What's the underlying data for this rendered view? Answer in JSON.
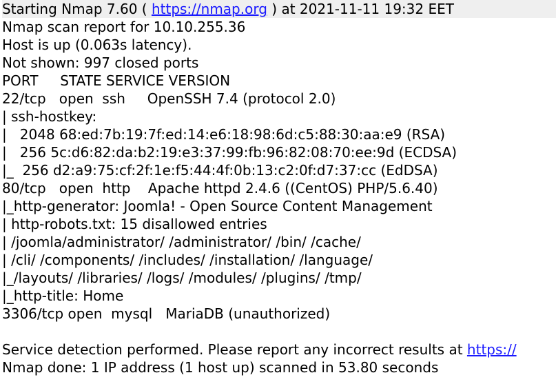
{
  "colors": {
    "text": "#000000",
    "link": "#1a1aff",
    "background": "#ffffff",
    "first_line_background": "#efefef"
  },
  "lines": [
    {
      "parts": [
        {
          "text": "Starting Nmap 7.60 ( "
        },
        {
          "text": "https://nmap.org",
          "link": true
        },
        {
          "text": " ) at 2021-11-11 19:32 EET"
        }
      ]
    },
    {
      "parts": [
        {
          "text": "Nmap scan report for 10.10.255.36"
        }
      ]
    },
    {
      "parts": [
        {
          "text": "Host is up (0.063s latency)."
        }
      ]
    },
    {
      "parts": [
        {
          "text": "Not shown: 997 closed ports"
        }
      ]
    },
    {
      "parts": [
        {
          "text": "PORT     STATE SERVICE VERSION"
        }
      ]
    },
    {
      "parts": [
        {
          "text": "22/tcp   open  ssh     OpenSSH 7.4 (protocol 2.0)"
        }
      ]
    },
    {
      "parts": [
        {
          "text": "| ssh-hostkey:"
        }
      ]
    },
    {
      "parts": [
        {
          "text": "|   2048 68:ed:7b:19:7f:ed:14:e6:18:98:6d:c5:88:30:aa:e9 (RSA)"
        }
      ]
    },
    {
      "parts": [
        {
          "text": "|   256 5c:d6:82:da:b2:19:e3:37:99:fb:96:82:08:70:ee:9d (ECDSA)"
        }
      ]
    },
    {
      "parts": [
        {
          "text": "|_  256 d2:a9:75:cf:2f:1e:f5:44:4f:0b:13:c2:0f:d7:37:cc (EdDSA)"
        }
      ]
    },
    {
      "parts": [
        {
          "text": "80/tcp   open  http    Apache httpd 2.4.6 ((CentOS) PHP/5.6.40)"
        }
      ]
    },
    {
      "parts": [
        {
          "text": "|_http-generator: Joomla! - Open Source Content Management"
        }
      ]
    },
    {
      "parts": [
        {
          "text": "| http-robots.txt: 15 disallowed entries"
        }
      ]
    },
    {
      "parts": [
        {
          "text": "| /joomla/administrator/ /administrator/ /bin/ /cache/"
        }
      ]
    },
    {
      "parts": [
        {
          "text": "| /cli/ /components/ /includes/ /installation/ /language/"
        }
      ]
    },
    {
      "parts": [
        {
          "text": "|_/layouts/ /libraries/ /logs/ /modules/ /plugins/ /tmp/"
        }
      ]
    },
    {
      "parts": [
        {
          "text": "|_http-title: Home"
        }
      ]
    },
    {
      "parts": [
        {
          "text": "3306/tcp open  mysql   MariaDB (unauthorized)"
        }
      ]
    },
    {
      "parts": [
        {
          "text": ""
        }
      ]
    },
    {
      "parts": [
        {
          "text": "Service detection performed. Please report any incorrect results at "
        },
        {
          "text": "https://",
          "link": true
        }
      ]
    },
    {
      "parts": [
        {
          "text": "Nmap done: 1 IP address (1 host up) scanned in 53.80 seconds"
        }
      ]
    }
  ]
}
